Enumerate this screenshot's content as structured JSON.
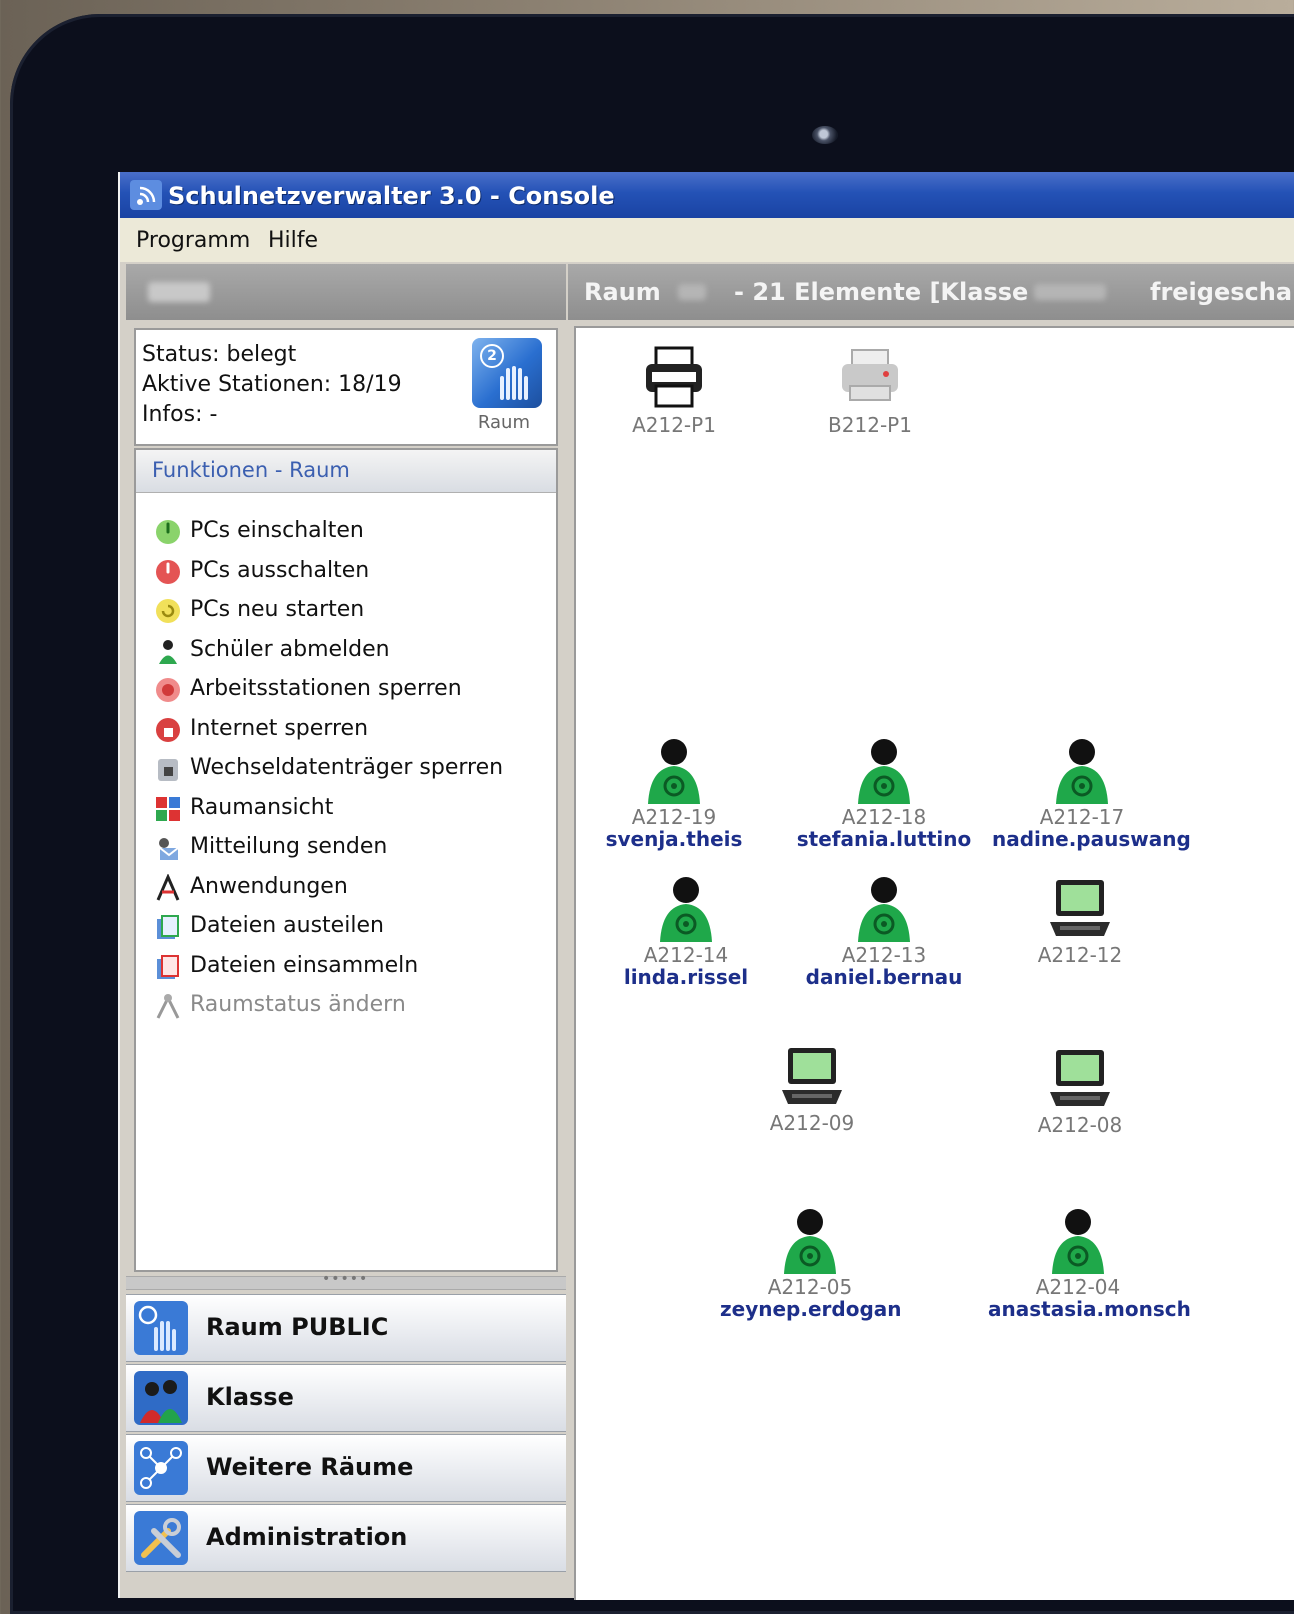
{
  "window": {
    "title": "Schulnetzverwalter 3.0 - Console"
  },
  "menu": [
    "Programm",
    "Hilfe"
  ],
  "status": {
    "state": "Status: belegt",
    "stations": "Aktive Stationen: 18/19",
    "infos": "Infos: -",
    "room_icon_label": "Raum",
    "room_icon_number": "2"
  },
  "functions": {
    "header": "Funktionen - Raum",
    "items": [
      {
        "label": "PCs einschalten",
        "icon": "power-on-icon",
        "enabled": true
      },
      {
        "label": "PCs ausschalten",
        "icon": "power-off-icon",
        "enabled": true
      },
      {
        "label": "PCs neu starten",
        "icon": "restart-icon",
        "enabled": true
      },
      {
        "label": "Schüler abmelden",
        "icon": "logout-user-icon",
        "enabled": true
      },
      {
        "label": "Arbeitsstationen sperren",
        "icon": "lock-stations-icon",
        "enabled": true
      },
      {
        "label": "Internet sperren",
        "icon": "internet-lock-icon",
        "enabled": true
      },
      {
        "label": "Wechseldatenträger sperren",
        "icon": "removable-media-lock-icon",
        "enabled": true
      },
      {
        "label": "Raumansicht",
        "icon": "room-view-icon",
        "enabled": true
      },
      {
        "label": "Mitteilung senden",
        "icon": "send-message-icon",
        "enabled": true
      },
      {
        "label": "Anwendungen",
        "icon": "applications-icon",
        "enabled": true
      },
      {
        "label": "Dateien austeilen",
        "icon": "distribute-files-icon",
        "enabled": true
      },
      {
        "label": "Dateien einsammeln",
        "icon": "collect-files-icon",
        "enabled": true
      },
      {
        "label": "Raumstatus ändern",
        "icon": "room-status-icon",
        "enabled": false
      }
    ]
  },
  "nav": [
    {
      "label": "Raum PUBLIC",
      "icon": "room-icon"
    },
    {
      "label": "Klasse",
      "icon": "class-icon"
    },
    {
      "label": "Weitere Räume",
      "icon": "more-rooms-icon"
    },
    {
      "label": "Administration",
      "icon": "administration-icon"
    }
  ],
  "room_header": {
    "prefix": "Raum",
    "count": "- 21 Elemente [Klasse",
    "suffix": "freigescha"
  },
  "stations": [
    {
      "id": "A212-P1",
      "user": "",
      "type": "printer"
    },
    {
      "id": "B212-P1",
      "user": "",
      "type": "printer-inactive"
    },
    {
      "id": "A212-19",
      "user": "svenja.theis",
      "type": "student"
    },
    {
      "id": "A212-18",
      "user": "stefania.luttino",
      "type": "student"
    },
    {
      "id": "A212-17",
      "user": "nadine.pauswang",
      "type": "student"
    },
    {
      "id": "A212-14",
      "user": "linda.rissel",
      "type": "student"
    },
    {
      "id": "A212-13",
      "user": "daniel.bernau",
      "type": "student"
    },
    {
      "id": "A212-12",
      "user": "",
      "type": "laptop"
    },
    {
      "id": "A212-09",
      "user": "",
      "type": "laptop"
    },
    {
      "id": "A212-08",
      "user": "",
      "type": "laptop"
    },
    {
      "id": "A212-05",
      "user": "zeynep.erdogan",
      "type": "student"
    },
    {
      "id": "A212-04",
      "user": "anastasia.monsch",
      "type": "student"
    }
  ],
  "colors": {
    "titlebar": "#2452b6",
    "student": "#1fa84a",
    "user_text": "#1d2f8a",
    "func_header_text": "#3b5fb0"
  }
}
